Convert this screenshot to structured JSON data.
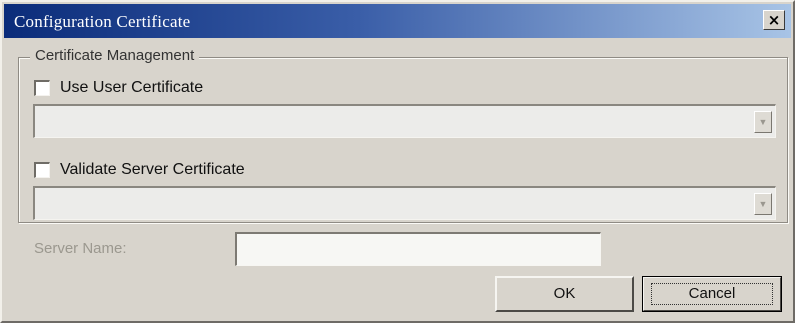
{
  "window": {
    "title": "Configuration Certificate",
    "close_label": "×"
  },
  "certificate_management": {
    "group_label": "Certificate Management",
    "use_user_certificate": {
      "label": "Use User Certificate",
      "checked": false,
      "dropdown_value": ""
    },
    "validate_server_certificate": {
      "label": "Validate Server Certificate",
      "checked": false,
      "dropdown_value": ""
    }
  },
  "server_name": {
    "label": "Server Name:",
    "value": "",
    "enabled": false
  },
  "buttons": {
    "ok_label": "OK",
    "cancel_label": "Cancel"
  },
  "colors": {
    "titlebar_start": "#0b2c7a",
    "titlebar_end": "#a8c4e6",
    "dialog_face": "#d8d4cc",
    "disabled_text": "#9b988f"
  },
  "icons": {
    "close": "close-icon",
    "dropdown_arrow": "chevron-down-icon"
  }
}
